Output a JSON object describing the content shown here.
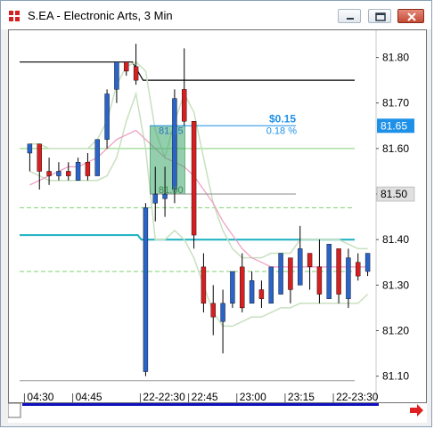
{
  "window": {
    "title": "S.EA - Electronic Arts, 3 Min",
    "controls": {
      "minimize": "minimize",
      "maximize": "maximize",
      "close": "close"
    }
  },
  "colors": {
    "up_candle": "#2a64c8",
    "down_candle": "#d42020",
    "ma_light": "#c8e0c0",
    "ma_pink": "#ef9ac0",
    "hline_black": "#000000",
    "hline_teal": "#1ab0c0",
    "hline_green": "#7ed070",
    "dashed_green": "#3aa050",
    "highlight_price": "#1e90e8",
    "current_price": "#e0e0e0",
    "selection_fill": "#3aa66a"
  },
  "price_axis": {
    "labels": [
      "81.80",
      "81.70",
      "81.60",
      "81.50",
      "81.40",
      "81.30",
      "81.20",
      "81.10"
    ],
    "highlighted_blue": "81.65",
    "highlighted_gray": "81.50"
  },
  "time_axis": {
    "labels": [
      "04:30",
      "04:45",
      "22-22:30",
      "22:45",
      "23:00",
      "23:15",
      "22-23:30"
    ]
  },
  "measure": {
    "change": "$0.15",
    "percent": "0.18 %",
    "high_label": "81.65",
    "low_label": "81.50"
  },
  "chart_data": {
    "type": "candlestick",
    "ylim": [
      81.07,
      81.85
    ],
    "candles": [
      {
        "o": 81.59,
        "h": 81.61,
        "l": 81.55,
        "c": 81.61
      },
      {
        "o": 81.61,
        "h": 81.61,
        "l": 81.51,
        "c": 81.55
      },
      {
        "o": 81.55,
        "h": 81.58,
        "l": 81.52,
        "c": 81.54
      },
      {
        "o": 81.54,
        "h": 81.57,
        "l": 81.53,
        "c": 81.55
      },
      {
        "o": 81.55,
        "h": 81.57,
        "l": 81.53,
        "c": 81.54
      },
      {
        "o": 81.53,
        "h": 81.58,
        "l": 81.53,
        "c": 81.57
      },
      {
        "o": 81.57,
        "h": 81.59,
        "l": 81.53,
        "c": 81.54
      },
      {
        "o": 81.54,
        "h": 81.62,
        "l": 81.54,
        "c": 81.62
      },
      {
        "o": 81.62,
        "h": 81.73,
        "l": 81.6,
        "c": 81.72
      },
      {
        "o": 81.73,
        "h": 81.79,
        "l": 81.7,
        "c": 81.79
      },
      {
        "o": 81.79,
        "h": 81.79,
        "l": 81.76,
        "c": 81.77
      },
      {
        "o": 81.78,
        "h": 81.83,
        "l": 81.74,
        "c": 81.75
      },
      {
        "o": 81.11,
        "h": 81.48,
        "l": 81.1,
        "c": 81.47
      },
      {
        "o": 81.48,
        "h": 81.56,
        "l": 81.44,
        "c": 81.5
      },
      {
        "o": 81.49,
        "h": 81.56,
        "l": 81.45,
        "c": 81.5
      },
      {
        "o": 81.51,
        "h": 81.73,
        "l": 81.48,
        "c": 81.71
      },
      {
        "o": 81.73,
        "h": 81.82,
        "l": 81.65,
        "c": 81.66
      },
      {
        "o": 81.66,
        "h": 81.66,
        "l": 81.38,
        "c": 81.41
      },
      {
        "o": 81.34,
        "h": 81.37,
        "l": 81.24,
        "c": 81.26
      },
      {
        "o": 81.26,
        "h": 81.3,
        "l": 81.19,
        "c": 81.23
      },
      {
        "o": 81.22,
        "h": 81.29,
        "l": 81.15,
        "c": 81.26
      },
      {
        "o": 81.26,
        "h": 81.33,
        "l": 81.25,
        "c": 81.33
      },
      {
        "o": 81.34,
        "h": 81.37,
        "l": 81.24,
        "c": 81.25
      },
      {
        "o": 81.26,
        "h": 81.33,
        "l": 81.26,
        "c": 81.31
      },
      {
        "o": 81.29,
        "h": 81.31,
        "l": 81.25,
        "c": 81.27
      },
      {
        "o": 81.26,
        "h": 81.33,
        "l": 81.26,
        "c": 81.34
      },
      {
        "o": 81.28,
        "h": 81.36,
        "l": 81.28,
        "c": 81.37
      },
      {
        "o": 81.36,
        "h": 81.36,
        "l": 81.26,
        "c": 81.29
      },
      {
        "o": 81.3,
        "h": 81.43,
        "l": 81.3,
        "c": 81.38
      },
      {
        "o": 81.37,
        "h": 81.37,
        "l": 81.29,
        "c": 81.34
      },
      {
        "o": 81.34,
        "h": 81.4,
        "l": 81.26,
        "c": 81.28
      },
      {
        "o": 81.27,
        "h": 81.39,
        "l": 81.27,
        "c": 81.39
      },
      {
        "o": 81.38,
        "h": 81.38,
        "l": 81.26,
        "c": 81.28
      },
      {
        "o": 81.27,
        "h": 81.38,
        "l": 81.25,
        "c": 81.36
      },
      {
        "o": 81.35,
        "h": 81.37,
        "l": 81.31,
        "c": 81.32
      },
      {
        "o": 81.33,
        "h": 81.37,
        "l": 81.32,
        "c": 81.37
      }
    ],
    "horizontal_lines": [
      {
        "price": 81.75,
        "style": "solid",
        "color": "black",
        "x_start": 0,
        "label": ""
      },
      {
        "price": 81.4,
        "style": "solid",
        "color": "teal",
        "x_start": 0
      },
      {
        "price": 81.6,
        "style": "solid",
        "color": "green",
        "x_start": 0
      },
      {
        "price": 81.47,
        "style": "dashed",
        "color": "green",
        "x_start": 0
      },
      {
        "price": 81.33,
        "style": "dashed",
        "color": "green",
        "x_start": 0
      },
      {
        "price": 81.09,
        "style": "solid",
        "color": "gray",
        "x_start": 0
      }
    ],
    "pink_ma": [
      81.52,
      81.53,
      81.54,
      81.55,
      81.56,
      81.56,
      81.57,
      81.58,
      81.6,
      81.62,
      81.63,
      81.64,
      81.62,
      81.6,
      81.58,
      81.57,
      81.56,
      81.54,
      81.51,
      81.48,
      81.44,
      81.41,
      81.38,
      81.36,
      81.35,
      81.34,
      81.34,
      81.34,
      81.34,
      81.34,
      81.34,
      81.34,
      81.34,
      81.34,
      81.34,
      81.34
    ],
    "band_upper": [
      81.61,
      81.61,
      81.6,
      81.6,
      81.6,
      81.6,
      81.6,
      81.62,
      81.66,
      81.74,
      81.78,
      81.79,
      81.77,
      81.64,
      81.58,
      81.66,
      81.72,
      81.68,
      81.58,
      81.48,
      81.42,
      81.38,
      81.36,
      81.36,
      81.36,
      81.37,
      81.37,
      81.37,
      81.4,
      81.4,
      81.4,
      81.4,
      81.4,
      81.39,
      81.38,
      81.38
    ],
    "band_lower": [
      81.55,
      81.54,
      81.53,
      81.53,
      81.53,
      81.53,
      81.53,
      81.53,
      81.54,
      81.58,
      81.66,
      81.72,
      81.6,
      81.4,
      81.4,
      81.42,
      81.4,
      81.36,
      81.3,
      81.24,
      81.21,
      81.21,
      81.22,
      81.23,
      81.23,
      81.24,
      81.25,
      81.25,
      81.26,
      81.26,
      81.26,
      81.26,
      81.26,
      81.26,
      81.26,
      81.28
    ]
  }
}
